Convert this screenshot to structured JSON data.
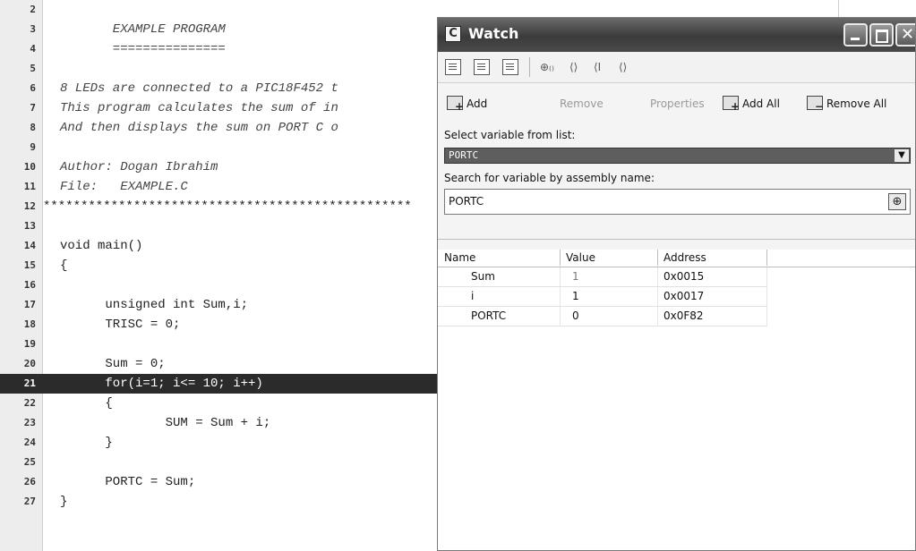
{
  "editor": {
    "lines": [
      {
        "no": "2",
        "text": "",
        "style": "plain"
      },
      {
        "no": "3",
        "text": "       EXAMPLE PROGRAM",
        "style": "comment"
      },
      {
        "no": "4",
        "text": "       ===============",
        "style": "comment"
      },
      {
        "no": "5",
        "text": "",
        "style": "plain"
      },
      {
        "no": "6",
        "text": "8 LEDs are connected to a PIC18F452 t",
        "style": "comment"
      },
      {
        "no": "7",
        "text": "This program calculates the sum of in",
        "style": "comment"
      },
      {
        "no": "8",
        "text": "And then displays the sum on PORT C o",
        "style": "comment"
      },
      {
        "no": "9",
        "text": "",
        "style": "plain"
      },
      {
        "no": "10",
        "text": "Author: Dogan Ibrahim",
        "style": "comment"
      },
      {
        "no": "11",
        "text": "File:   EXAMPLE.C",
        "style": "comment"
      },
      {
        "no": "12",
        "text": "*************************************************",
        "style": "stars"
      },
      {
        "no": "13",
        "text": "",
        "style": "plain"
      },
      {
        "no": "14",
        "text": "void main()",
        "style": "plain"
      },
      {
        "no": "15",
        "text": "{",
        "style": "plain"
      },
      {
        "no": "16",
        "text": "",
        "style": "plain"
      },
      {
        "no": "17",
        "text": "      unsigned int Sum,i;",
        "style": "plain"
      },
      {
        "no": "18",
        "text": "      TRISC = 0;",
        "style": "plain"
      },
      {
        "no": "19",
        "text": "",
        "style": "plain"
      },
      {
        "no": "20",
        "text": "      Sum = 0;",
        "style": "plain"
      },
      {
        "no": "21",
        "text": "      for(i=1; i<= 10; i++)",
        "style": "plain",
        "active": true
      },
      {
        "no": "22",
        "text": "      {",
        "style": "plain"
      },
      {
        "no": "23",
        "text": "              SUM = Sum + i;",
        "style": "plain"
      },
      {
        "no": "24",
        "text": "      }",
        "style": "plain"
      },
      {
        "no": "25",
        "text": "",
        "style": "plain"
      },
      {
        "no": "26",
        "text": "      PORTC = Sum;",
        "style": "plain"
      },
      {
        "no": "27",
        "text": "}",
        "style": "plain"
      }
    ]
  },
  "watch": {
    "app_icon": "C",
    "title": "Watch",
    "toolbar_icons": [
      "run-icon",
      "step-into-icon",
      "step-over-icon",
      "step-out-icon",
      "run-to-cursor-icon",
      "jump-icon",
      "breakpoint-icon"
    ],
    "toolbar_glyphs": [
      "⊕₍₎",
      "⟨⟩",
      "⟨I",
      "⟨⟩"
    ],
    "actions": {
      "add": "Add",
      "remove": "Remove",
      "properties": "Properties",
      "add_all": "Add All",
      "remove_all": "Remove All"
    },
    "select_label": "Select variable from list:",
    "select_value": "PORTC",
    "search_label": "Search for variable by assembly name:",
    "search_value": "PORTC",
    "table": {
      "columns": [
        "Name",
        "Value",
        "Address"
      ],
      "rows": [
        {
          "name": "Sum",
          "value": "1",
          "address": "0x0015",
          "value_muted": true
        },
        {
          "name": "i",
          "value": "1",
          "address": "0x0017",
          "value_muted": false
        },
        {
          "name": "PORTC",
          "value": "0",
          "address": "0x0F82",
          "value_muted": false
        }
      ]
    }
  }
}
